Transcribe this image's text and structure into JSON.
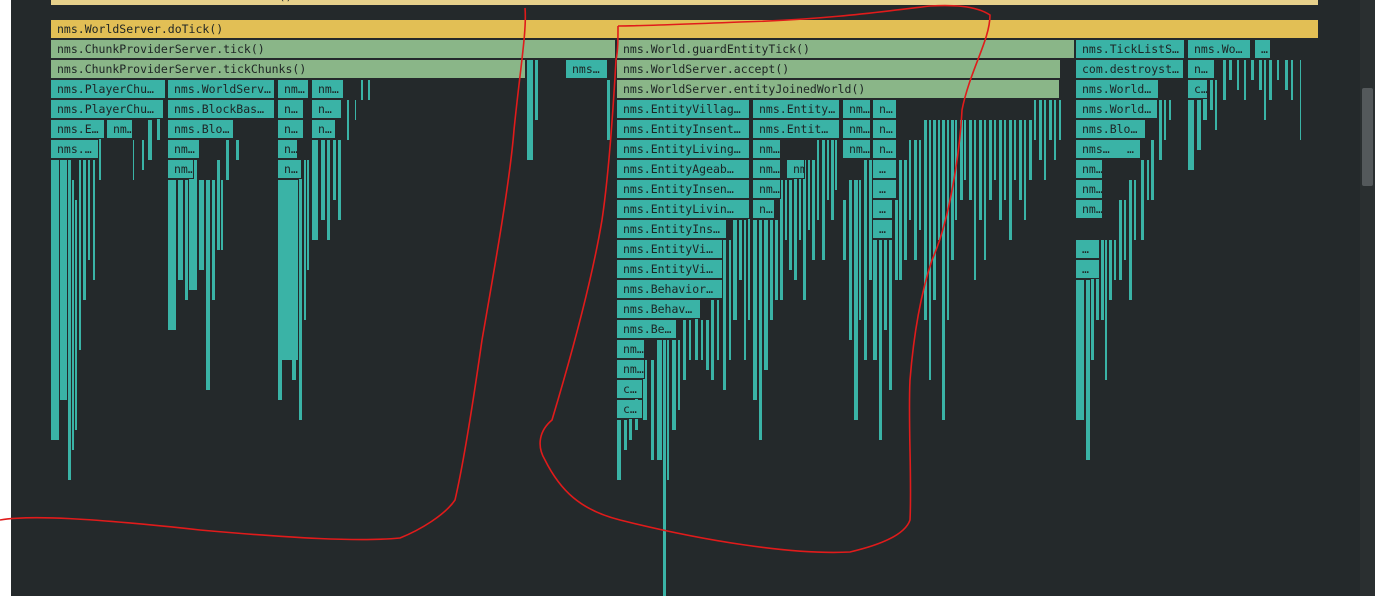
{
  "colors": {
    "background": "#24292b",
    "frame_yellow_light": "#e6d08b",
    "frame_yellow": "#e2bf55",
    "frame_green": "#8ab688",
    "frame_teal": "#3ab3a6",
    "annotation_red": "#e01b1b"
  },
  "flamegraph": {
    "frames": [
      {
        "label": "nms.MinecraftServer.tickChildren()",
        "color": "frame_yellow_light"
      },
      {
        "label": "nms.WorldServer.doTick()",
        "color": "frame_yellow"
      },
      {
        "label": "nms.ChunkProviderServer.tick()",
        "color": "frame_green"
      },
      {
        "label": "nms.World.guardEntityTick()",
        "color": "frame_green"
      },
      {
        "label": "nms.TickListS…",
        "color": "frame_teal"
      },
      {
        "label": "nms.Wo…",
        "color": "frame_teal"
      },
      {
        "label": "…",
        "color": "frame_teal"
      },
      {
        "label": "nms.ChunkProviderServer.tickChunks()",
        "color": "frame_green"
      },
      {
        "label": "nms…",
        "color": "frame_teal"
      },
      {
        "label": "nms.WorldServer.accept()",
        "color": "frame_green"
      },
      {
        "label": "com.destroyst…",
        "color": "frame_teal"
      },
      {
        "label": "n…",
        "color": "frame_teal"
      },
      {
        "label": "nms.PlayerChu…",
        "color": "frame_teal"
      },
      {
        "label": "nms.WorldServ…",
        "color": "frame_teal"
      },
      {
        "label": "nm…",
        "color": "frame_teal"
      },
      {
        "label": "nm…",
        "color": "frame_teal"
      },
      {
        "label": "nms.WorldServer.entityJoinedWorld()",
        "color": "frame_green"
      },
      {
        "label": "nms.World…",
        "color": "frame_teal"
      },
      {
        "label": "c…",
        "color": "frame_teal"
      },
      {
        "label": "nms.PlayerChu…",
        "color": "frame_teal"
      },
      {
        "label": "nms.BlockBas…",
        "color": "frame_teal"
      },
      {
        "label": "n…",
        "color": "frame_teal"
      },
      {
        "label": "n…",
        "color": "frame_teal"
      },
      {
        "label": "nms.EntityVillag…",
        "color": "frame_teal"
      },
      {
        "label": "nms.Entity…",
        "color": "frame_teal"
      },
      {
        "label": "nm…",
        "color": "frame_teal"
      },
      {
        "label": "n…",
        "color": "frame_teal"
      },
      {
        "label": "nms.World…",
        "color": "frame_teal"
      },
      {
        "label": "nms.E…",
        "color": "frame_teal"
      },
      {
        "label": "nm…",
        "color": "frame_teal"
      },
      {
        "label": "nms.Blo…",
        "color": "frame_teal"
      },
      {
        "label": "n…",
        "color": "frame_teal"
      },
      {
        "label": "n…",
        "color": "frame_teal"
      },
      {
        "label": "nms.EntityInsent…",
        "color": "frame_teal"
      },
      {
        "label": "nms.Entit…",
        "color": "frame_teal"
      },
      {
        "label": "nm…",
        "color": "frame_teal"
      },
      {
        "label": "n…",
        "color": "frame_teal"
      },
      {
        "label": "nms.Blo…",
        "color": "frame_teal"
      },
      {
        "label": "nms.…",
        "color": "frame_teal"
      },
      {
        "label": "nm…",
        "color": "frame_teal"
      },
      {
        "label": "n…",
        "color": "frame_teal"
      },
      {
        "label": "nms.EntityLiving…",
        "color": "frame_teal"
      },
      {
        "label": "nm…",
        "color": "frame_teal"
      },
      {
        "label": "nm…",
        "color": "frame_teal"
      },
      {
        "label": "n…",
        "color": "frame_teal"
      },
      {
        "label": "nms…",
        "color": "frame_teal"
      },
      {
        "label": "…",
        "color": "frame_teal"
      },
      {
        "label": "nm…",
        "color": "frame_teal"
      },
      {
        "label": "n…",
        "color": "frame_teal"
      },
      {
        "label": "nms.EntityAgeab…",
        "color": "frame_teal"
      },
      {
        "label": "nm…",
        "color": "frame_teal"
      },
      {
        "label": "nm…",
        "color": "frame_teal"
      },
      {
        "label": "…",
        "color": "frame_teal"
      },
      {
        "label": "nm…",
        "color": "frame_teal"
      },
      {
        "label": "nms.EntityInsen…",
        "color": "frame_teal"
      },
      {
        "label": "nm…",
        "color": "frame_teal"
      },
      {
        "label": "…",
        "color": "frame_teal"
      },
      {
        "label": "nm…",
        "color": "frame_teal"
      },
      {
        "label": "nms.EntityLivin…",
        "color": "frame_teal"
      },
      {
        "label": "n…",
        "color": "frame_teal"
      },
      {
        "label": "…",
        "color": "frame_teal"
      },
      {
        "label": "nm…",
        "color": "frame_teal"
      },
      {
        "label": "nms.EntityIns…",
        "color": "frame_teal"
      },
      {
        "label": "…",
        "color": "frame_teal"
      },
      {
        "label": "nms.EntityVi…",
        "color": "frame_teal"
      },
      {
        "label": "…",
        "color": "frame_teal"
      },
      {
        "label": "nms.EntityVi…",
        "color": "frame_teal"
      },
      {
        "label": "…",
        "color": "frame_teal"
      },
      {
        "label": "nms.Behavior…",
        "color": "frame_teal"
      },
      {
        "label": "nms.Behav…",
        "color": "frame_teal"
      },
      {
        "label": "nms.Be…",
        "color": "frame_teal"
      },
      {
        "label": "nm…",
        "color": "frame_teal"
      },
      {
        "label": "nm…",
        "color": "frame_teal"
      },
      {
        "label": "c…",
        "color": "frame_teal"
      },
      {
        "label": "c…",
        "color": "frame_teal"
      }
    ]
  }
}
